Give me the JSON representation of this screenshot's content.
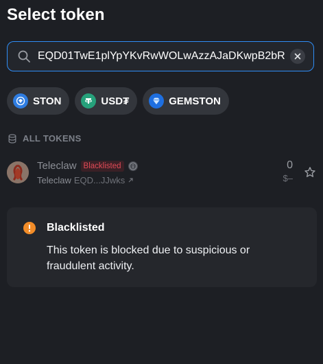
{
  "title": "Select token",
  "search": {
    "value": "EQD01TwE1plYpYKvRwWOLwAzzAJaDKwpB2bR",
    "placeholder": "Search"
  },
  "chips": [
    {
      "label": "STON",
      "icon": "ston-logo-icon",
      "color": "#2f7de1"
    },
    {
      "label": "USD₮",
      "icon": "tether-logo-icon",
      "color": "#26a17b"
    },
    {
      "label": "GEMSTON",
      "icon": "gemston-logo-icon",
      "color": "#1e6fe0"
    }
  ],
  "section": {
    "label": "ALL TOKENS",
    "icon": "database-icon"
  },
  "token": {
    "name": "Teleclaw",
    "badge": "Blacklisted",
    "symbol": "Teleclaw",
    "address": "EQD...JJwks",
    "balance": "0",
    "usd": "$–"
  },
  "alert": {
    "title": "Blacklisted",
    "body": "This token is blocked due to suspicious or fraudulent activity.",
    "color": "#f28c28"
  },
  "colors": {
    "accent": "#2f8ef7",
    "danger": "#e04a56"
  }
}
